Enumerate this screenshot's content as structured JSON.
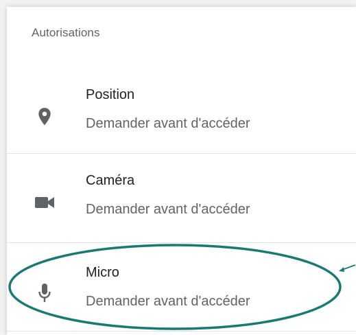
{
  "section": {
    "title": "Autorisations"
  },
  "permissions": [
    {
      "name": "Position",
      "status": "Demander avant d'accéder",
      "icon": "location-pin-icon"
    },
    {
      "name": "Caméra",
      "status": "Demander avant d'accéder",
      "icon": "video-camera-icon"
    },
    {
      "name": "Micro",
      "status": "Demander avant d'accéder",
      "icon": "microphone-icon"
    }
  ],
  "colors": {
    "highlight": "#1a7a72",
    "icon": "#5f6368"
  }
}
